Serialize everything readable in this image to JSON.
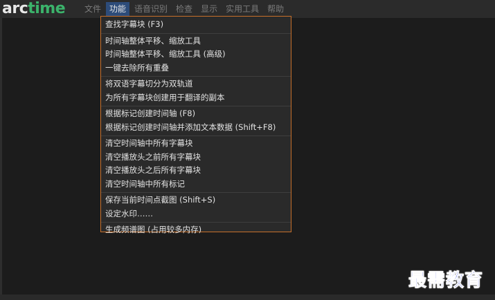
{
  "app": {
    "logo_arc": "arc",
    "logo_time": "time"
  },
  "menubar": {
    "items": [
      {
        "label": "文件",
        "active": false
      },
      {
        "label": "功能",
        "active": true
      },
      {
        "label": "语音识别",
        "active": false
      },
      {
        "label": "检查",
        "active": false
      },
      {
        "label": "显示",
        "active": false
      },
      {
        "label": "实用工具",
        "active": false
      },
      {
        "label": "帮助",
        "active": false
      }
    ]
  },
  "dropdown": {
    "groups": [
      [
        "查找字幕块 (F3)"
      ],
      [
        "时间轴整体平移、缩放工具",
        "时间轴整体平移、缩放工具 (高级)",
        "一键去除所有重叠"
      ],
      [
        "将双语字幕切分为双轨道",
        "为所有字幕块创建用于翻译的副本"
      ],
      [
        "根据标记创建时间轴 (F8)",
        "根据标记创建时间轴并添加文本数据 (Shift+F8)"
      ],
      [
        "清空时间轴中所有字幕块",
        "清空播放头之前所有字幕块",
        "清空播放头之后所有字幕块",
        "清空时间轴中所有标记"
      ],
      [
        "保存当前时间点截图 (Shift+S)",
        "设定水印……"
      ],
      [
        "生成频谱图 (占用较多内存)"
      ]
    ]
  },
  "watermark": {
    "text": "最需教育"
  },
  "colors": {
    "menu_active_bg": "#2d4c7a",
    "dropdown_border": "#c8702a",
    "logo_green": "#3bb36b",
    "watermark_blue": "#1a2fd6"
  }
}
